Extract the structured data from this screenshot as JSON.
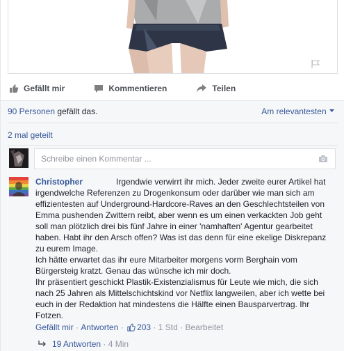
{
  "actions": {
    "like": "Gefällt mir",
    "comment": "Kommentieren",
    "share": "Teilen"
  },
  "likes": {
    "count": "90 Personen",
    "suffix": " gefällt das.",
    "sort": "Am relevantesten"
  },
  "shares": "2 mal geteilt",
  "comment_box": {
    "placeholder": "Schreibe einen Kommentar ..."
  },
  "comment": {
    "author": "Christopher",
    "first": "Irgendwie verwirrt ihr mich. Jeder zweite eurer Artikel hat irgendwelche Referenzen zu Drogenkonsum oder darüber wie man sich am effizientesten auf Underground-Hardcore-Raves an den Geschlechtsteilen von Emma pushenden Zwittern reibt, aber wenn es um einen verkackten Job geht soll man plötzlich drei bis fünf Jahre in einer 'namhaften' Agentur gearbeitet haben. Habt ihr den Arsch offen? Was ist das denn für eine ekelige Diskrepanz zu eurem Image.",
    "second": "Ich hätte erwartet das ihr eure Mitarbeiter morgens vorm Berghain vom Bürgersteig kratzt. Genau das wünsche ich mir doch.",
    "third": "Ihr präsentiert geschickt Plastik-Existenzialismus für Leute wie mich, die sich nach 25 Jahren als Mittelschichtskind vor Netflix langweilen, aber ich wette bei euch in der Redaktion hat mindestens die Hälfte einen Bausparvertrag. Ihr Fotzen.",
    "like": "Gefällt mir",
    "dot1": " · ",
    "reply": "Antworten",
    "dot2": " · ",
    "reactions": "203",
    "dot3": " · ",
    "time": "1 Std",
    "dot4": " · ",
    "edited": "Bearbeitet"
  },
  "replies": {
    "label": "19 Antworten",
    "dot": " · ",
    "time": "4 Min"
  },
  "colors": {
    "link": "#365899",
    "muted": "#90949c",
    "background": "#f6f7f9"
  }
}
